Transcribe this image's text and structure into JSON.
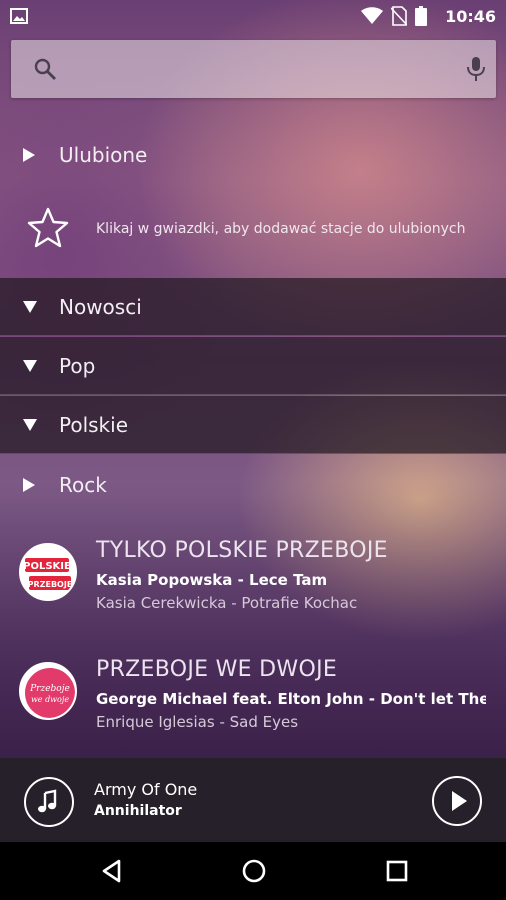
{
  "status_bar": {
    "time": "10:46",
    "icons": [
      "image-icon",
      "wifi-icon",
      "no-sim-icon",
      "battery-icon"
    ]
  },
  "search": {
    "placeholder": "",
    "value": "",
    "icons": [
      "search-icon",
      "mic-icon"
    ]
  },
  "favorites": {
    "label": "Ulubione",
    "hint": "Klikaj w gwiazdki, aby dodawać stacje do ulubionych"
  },
  "categories": [
    {
      "label": "Nowosci",
      "expanded": true
    },
    {
      "label": "Pop",
      "expanded": true
    },
    {
      "label": "Polskie",
      "expanded": true
    },
    {
      "label": "Rock",
      "expanded": false
    }
  ],
  "stations": [
    {
      "name": "TYLKO POLSKIE PRZEBOJE",
      "now_playing": "Kasia Popowska - Lece Tam",
      "previous": "Kasia Cerekwicka - Potrafie Kochac",
      "logo_text": [
        "POLSKIE",
        "PRZEBOJE"
      ]
    },
    {
      "name": "PRZEBOJE WE DWOJE",
      "now_playing": "George Michael feat. Elton John - Don't let The S...",
      "previous": "Enrique Iglesias - Sad Eyes",
      "logo_text": [
        "Przeboje",
        "we dwoje"
      ]
    }
  ],
  "player": {
    "track": "Army Of One",
    "artist": "Annihilator"
  },
  "colors": {
    "accent_red": "#e3243b",
    "accent_pink": "#e23a6a",
    "player_bg": "#25202a"
  }
}
